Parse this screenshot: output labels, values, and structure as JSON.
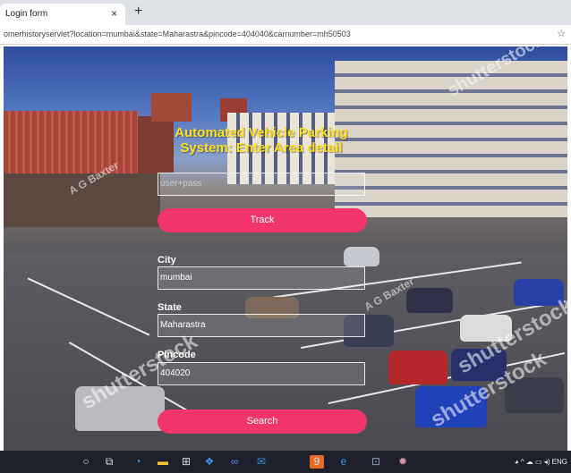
{
  "browser": {
    "tab_title": "Login form",
    "tab_close": "×",
    "new_tab": "+",
    "url": "omerhistoryservlet?location=mumbai&state=Maharastra&pincode=404040&carnumber=mh50503",
    "bookmark": "☆"
  },
  "watermarks": [
    "shutterstock",
    "A G Baxter",
    "A G Baxter",
    "shutterstock",
    "shutterstock",
    "shutterstock"
  ],
  "form": {
    "heading_line1": "Automated Vehicle Parking",
    "heading_line2": "System: Enter Area detail",
    "user_pass_placeholder": "user+pass",
    "track_button": "Track",
    "city_label": "City",
    "city_value": "mumbai",
    "state_label": "State",
    "state_value": "Maharastra",
    "pincode_label": "Pincode",
    "pincode_value": "404020",
    "search_button": "Search"
  },
  "taskbar": {
    "icons": [
      "start-icon",
      "task-view-icon",
      "edge-icon",
      "file-explorer-icon",
      "store-icon",
      "dropbox-icon",
      "link-icon",
      "mail-icon",
      "app-icon",
      "ie-icon",
      "app2-icon",
      "app3-icon"
    ],
    "tray": "ENG"
  },
  "colors": {
    "heading": "#ffe020",
    "button": "#f2356b"
  }
}
